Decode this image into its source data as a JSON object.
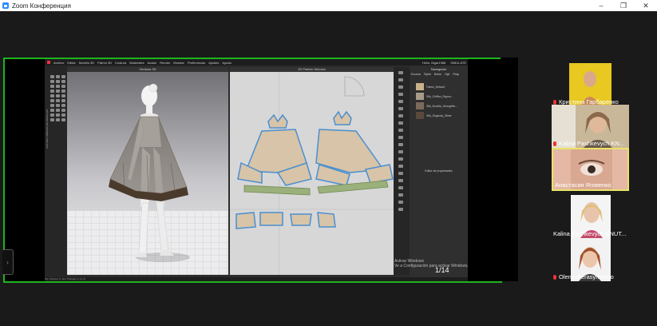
{
  "window": {
    "title": "Zoom Конференция",
    "minimize": "–",
    "restore": "❐",
    "close": "✕"
  },
  "share": {
    "menu": [
      "Archivo",
      "Editar",
      "Modelo 3D",
      "Patrón 3D",
      "Costura",
      "Materiales",
      "Avatar",
      "Render",
      "Mostrar",
      "Preferencias",
      "Ajustes",
      "Ayuda"
    ],
    "top_right": [
      "Hello, Mgar1968",
      "SIMULATE"
    ],
    "view3d_title": "Ventana 3D",
    "view2d_title": "2D Pattern Window",
    "left_vertical_text": "HISTORIA   LIBRERÍA DE MÓDULOS",
    "panel_title": "Navegador",
    "panel_tabs": [
      "Escena",
      "Tejido",
      "Botón",
      "Ojal",
      "Pesp"
    ],
    "materials": [
      "Fabric_Default",
      "Silk_Chiffon_Rayon...",
      "Silk_Double_Georgette...",
      "Silk_Organdy_Silver"
    ],
    "properties_title": "Editor de propiedades",
    "watermark_line1": "Activar Windows",
    "watermark_line2": "Ve a Configuración para activar Windows.",
    "page_indicator": "1/14",
    "status_text": "Sim Vertices: 0, Sim Triangles: 0 (0, 0)"
  },
  "participants": [
    {
      "name": "Кристина Гарбаренко",
      "muted": true
    },
    {
      "name": "Kalina Pashkevych KN...",
      "muted": true
    },
    {
      "name": "Анастасия Яговенко",
      "muted": false,
      "speaking": true
    },
    {
      "name": "Kalina Pashkevych KNUT...",
      "muted": false
    },
    {
      "name": "Olena Gerasymenko",
      "muted": true
    }
  ],
  "colors": {
    "share_border": "#1db41d",
    "speaking_border": "#e8e36a",
    "pattern_outline": "#4a8fd0",
    "pattern_fill": "#d8c4a8",
    "rib_fill": "#9bb07a",
    "muted_icon": "#e33333"
  }
}
